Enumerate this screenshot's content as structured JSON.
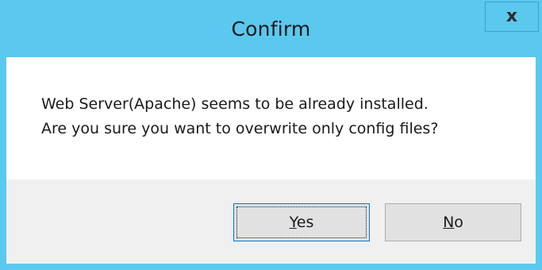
{
  "window": {
    "title": "Confirm",
    "close_glyph": "x"
  },
  "message": {
    "line1": "Web Server(Apache) seems to be already installed.",
    "line2": "Are you sure you want to overwrite only config files?"
  },
  "buttons": {
    "yes": {
      "mnemonic": "Y",
      "rest": "es"
    },
    "no": {
      "mnemonic": "N",
      "rest": "o"
    }
  },
  "colors": {
    "titlebar": "#5bc8ee",
    "content_bg": "#ffffff",
    "footer_bg": "#f0f0f0",
    "button_bg": "#e1e1e1",
    "default_button_border": "#0078d7"
  }
}
